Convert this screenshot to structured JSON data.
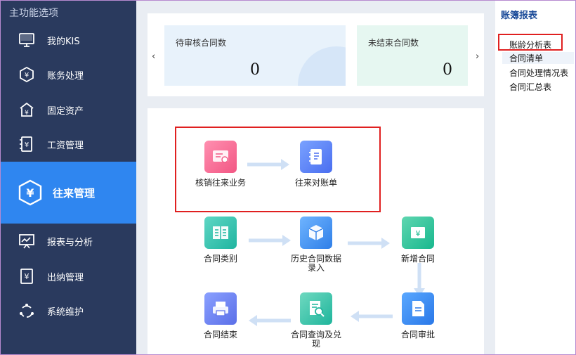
{
  "sidebar": {
    "header": "主功能选项",
    "items": [
      {
        "label": "我的KIS",
        "icon": "monitor-icon"
      },
      {
        "label": "账务处理",
        "icon": "ledger-icon"
      },
      {
        "label": "固定资产",
        "icon": "building-icon"
      },
      {
        "label": "工资管理",
        "icon": "salary-icon"
      },
      {
        "label": "往来管理",
        "icon": "exchange-icon",
        "active": true
      },
      {
        "label": "报表与分析",
        "icon": "chart-board-icon"
      },
      {
        "label": "出纳管理",
        "icon": "cashier-icon"
      },
      {
        "label": "系统维护",
        "icon": "maintenance-icon"
      }
    ]
  },
  "stats": {
    "pending_label": "待审核合同数",
    "pending_value": "0",
    "open_label": "未结束合同数",
    "open_value": "0",
    "prev_arrow": "‹",
    "next_arrow": "›"
  },
  "flow": {
    "nodes": {
      "writeoff": "核销往来业务",
      "reconcile": "往来对账单",
      "contract_type": "合同类别",
      "history_entry": "历史合同数据录入",
      "new_contract": "新增合同",
      "contract_end": "合同结束",
      "contract_query": "合同查询及兑现",
      "contract_approve": "合同审批"
    }
  },
  "reports": {
    "title": "账簿报表",
    "items": [
      "账龄分析表",
      "合同清单",
      "合同处理情况表",
      "合同汇总表"
    ]
  },
  "colors": {
    "sidebar_bg": "#2a3a5e",
    "active_bg": "#2f86f0",
    "highlight": "#e02020"
  }
}
